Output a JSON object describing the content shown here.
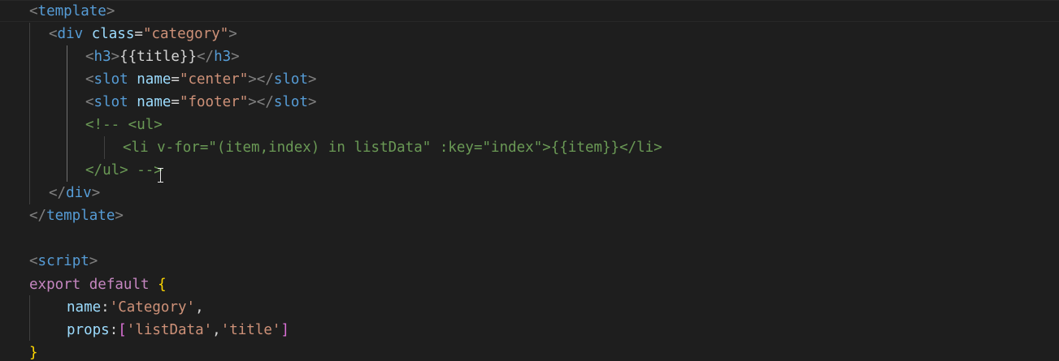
{
  "editor": {
    "language": "vue",
    "theme_background": "#1e1e1e",
    "lines": [
      {
        "id": "l1",
        "parts": [
          "<",
          "template",
          ">"
        ]
      },
      {
        "id": "l2",
        "parts": [
          "<",
          "div",
          "class",
          "=",
          "\"category\"",
          ">"
        ]
      },
      {
        "id": "l3",
        "parts": [
          "<",
          "h3",
          ">",
          "{{title}}",
          "</",
          "h3",
          ">"
        ]
      },
      {
        "id": "l4",
        "parts": [
          "<",
          "slot",
          "name",
          "=",
          "\"center\"",
          "></",
          "slot",
          ">"
        ]
      },
      {
        "id": "l5",
        "parts": [
          "<",
          "slot",
          "name",
          "=",
          "\"footer\"",
          "></",
          "slot",
          ">"
        ]
      },
      {
        "id": "l6",
        "parts": [
          "<!-- <ul>"
        ]
      },
      {
        "id": "l7",
        "parts": [
          "<li v-for=\"(item,index) in listData\" :key=\"index\">{{item}}</li>"
        ]
      },
      {
        "id": "l8",
        "parts": [
          "</ul> -->"
        ]
      },
      {
        "id": "l9",
        "parts": [
          "</",
          "div",
          ">"
        ]
      },
      {
        "id": "l10",
        "parts": [
          "</",
          "template",
          ">"
        ]
      },
      {
        "id": "l11",
        "parts": []
      },
      {
        "id": "l12",
        "parts": [
          "<",
          "script",
          ">"
        ]
      },
      {
        "id": "l13",
        "parts": [
          "export",
          "default",
          "{"
        ]
      },
      {
        "id": "l14",
        "parts": [
          "name",
          ":",
          "'Category'",
          ","
        ]
      },
      {
        "id": "l15",
        "parts": [
          "props",
          ":",
          "[",
          "'listData'",
          ",",
          "'title'",
          "]"
        ]
      },
      {
        "id": "l16",
        "parts": [
          "}"
        ]
      }
    ]
  }
}
